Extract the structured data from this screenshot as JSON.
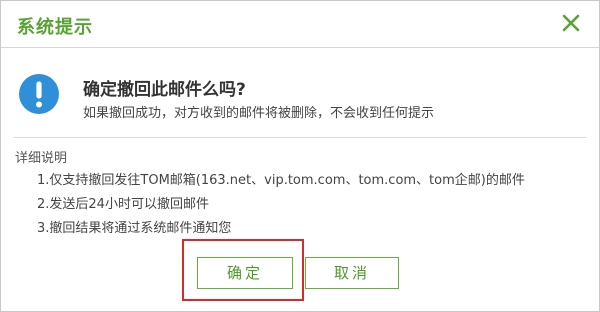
{
  "dialog": {
    "title": "系统提示",
    "question": "确定撤回此邮件么吗?",
    "subtext": "如果撤回成功，对方收到的邮件将被删除，不会收到任何提示",
    "details_title": "详细说明",
    "details": [
      "1.仅支持撤回发往TOM邮箱(163.net、vip.tom.com、tom.com、tom企邮)的邮件",
      "2.发送后24小时可以撤回邮件",
      "3.撤回结果将通过系统邮件通知您"
    ],
    "buttons": {
      "confirm": "确定",
      "cancel": "取消"
    }
  },
  "icons": {
    "close": "close-icon",
    "alert": "exclamation-circle-icon"
  },
  "colors": {
    "accent_green": "#5aa233",
    "alert_blue": "#2f8fd8",
    "highlight_red": "#d62b2b"
  }
}
